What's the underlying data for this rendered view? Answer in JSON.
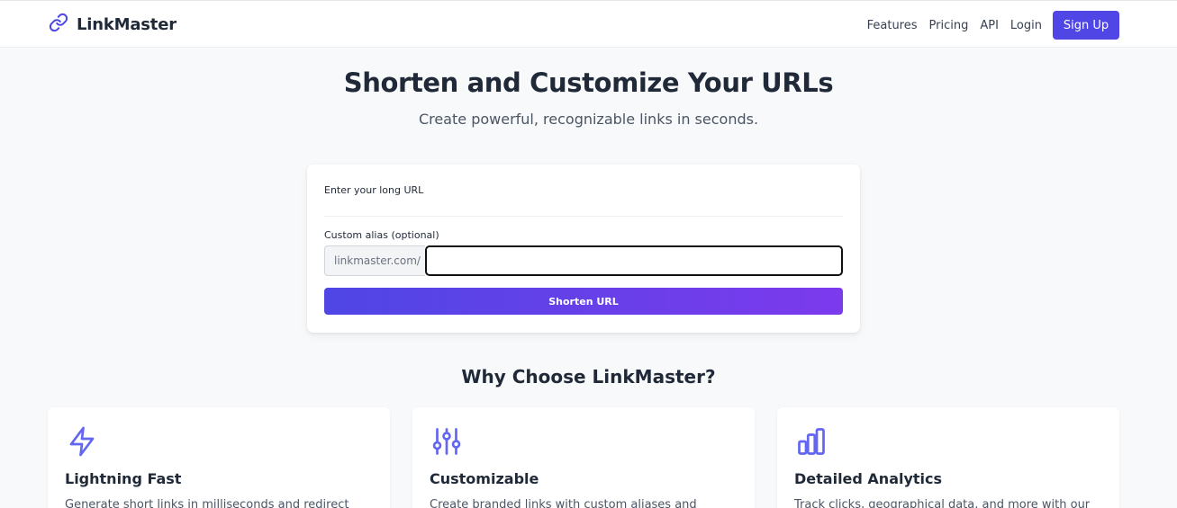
{
  "nav": {
    "brand": "LinkMaster",
    "links": [
      "Features",
      "Pricing",
      "API",
      "Login"
    ],
    "signup": "Sign Up"
  },
  "hero": {
    "title": "Shorten and Customize Your URLs",
    "subtitle": "Create powerful, recognizable links in seconds."
  },
  "form": {
    "url_label": "Enter your long URL",
    "url_value": "",
    "alias_label": "Custom alias (optional)",
    "alias_prefix": "linkmaster.com/",
    "alias_value": "",
    "button": "Shorten URL"
  },
  "features": {
    "title": "Why Choose LinkMaster?",
    "items": [
      {
        "icon": "lightning-icon",
        "title": "Lightning Fast",
        "desc": "Generate short links in milliseconds and redirect"
      },
      {
        "icon": "sliders-icon",
        "title": "Customizable",
        "desc": "Create branded links with custom aliases and"
      },
      {
        "icon": "bar-chart-icon",
        "title": "Detailed Analytics",
        "desc": "Track clicks, geographical data, and more with our"
      }
    ]
  },
  "colors": {
    "accent": "#4f46e5",
    "gradient_end": "#7c3aed",
    "icon": "#6366f1"
  }
}
